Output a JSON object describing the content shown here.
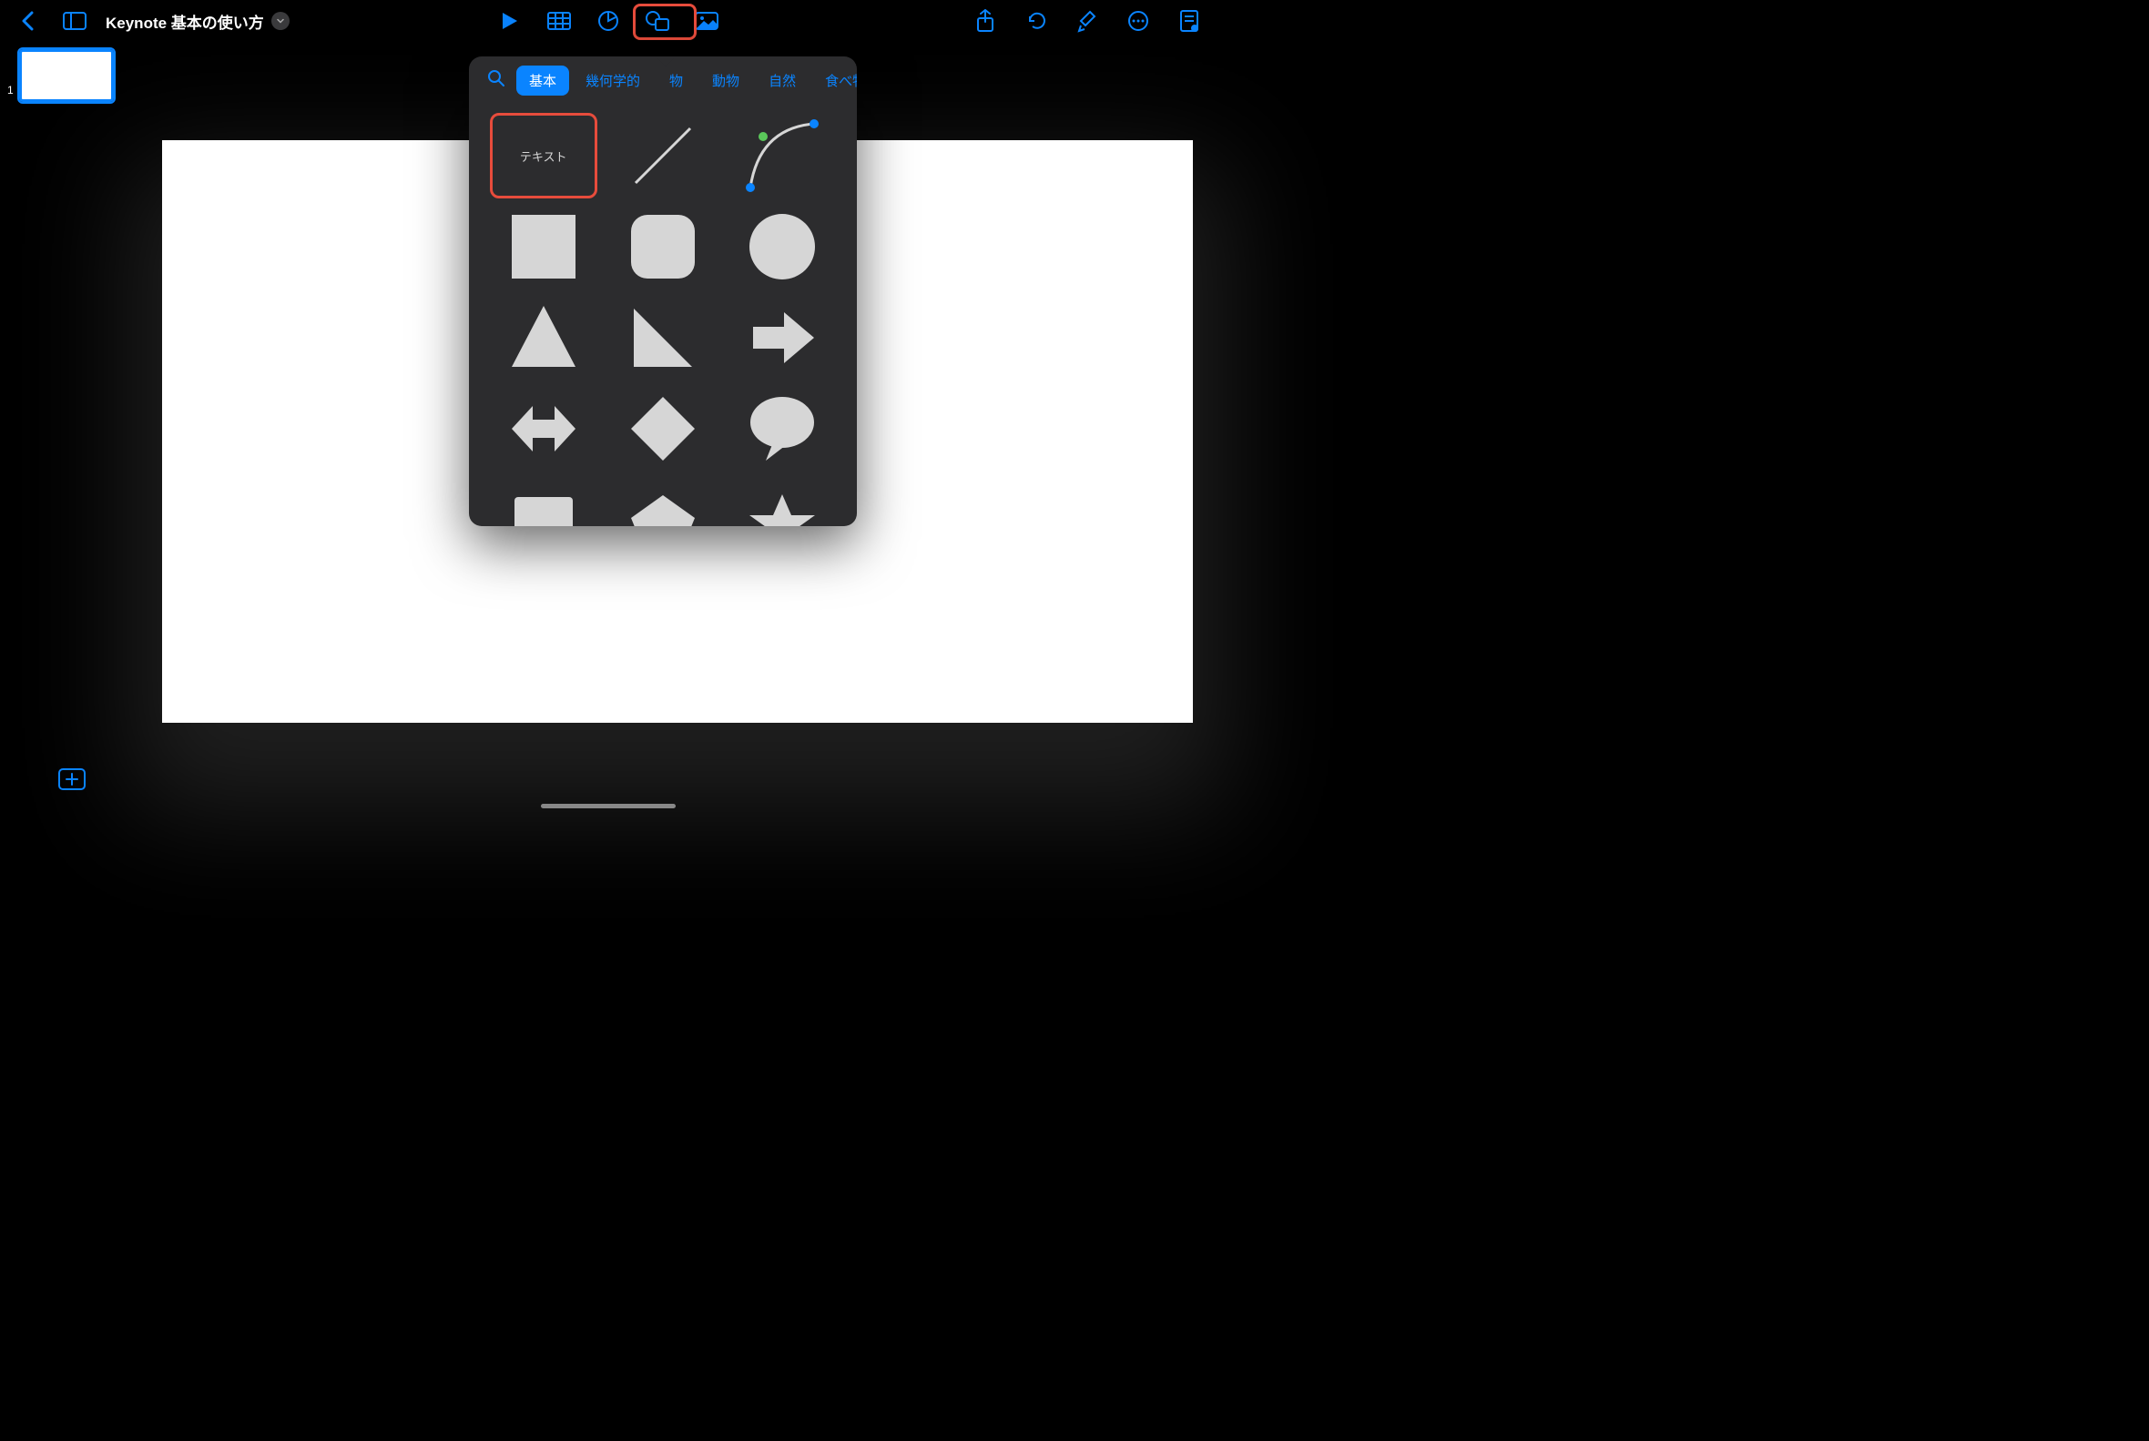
{
  "doc_title": "Keynote 基本の使い方",
  "slide_number": "1",
  "popover": {
    "tabs": {
      "basic": "基本",
      "geometric": "幾何学的",
      "objects": "物",
      "animals": "動物",
      "nature": "自然",
      "food": "食べ物"
    },
    "text_shape_label": "テキスト"
  }
}
